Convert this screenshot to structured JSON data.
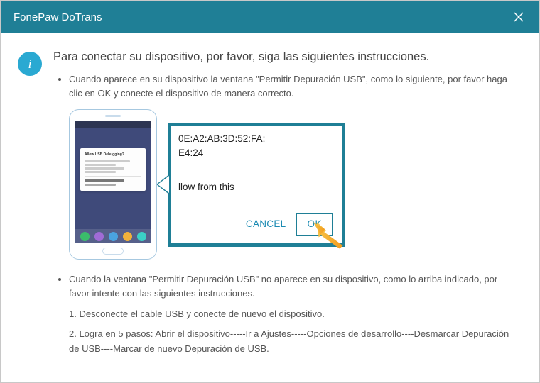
{
  "window": {
    "title": "FonePaw DoTrans"
  },
  "heading": "Para conectar su dispositivo, por favor, siga las siguientes instrucciones.",
  "bullets": {
    "item1": "Cuando aparece en su dispositivo la ventana \"Permitir Depuración USB\", como lo siguiente, por favor haga clic en OK y conecte el dispositivo de manera correcto.",
    "item2": "Cuando la ventana \"Permitir Depuración USB\" no aparece en su dispositivo, como lo arriba indicado, por favor intente con las siguientes instrucciones."
  },
  "illustration": {
    "phone_dialog_title": "Allow USB Debugging?",
    "zoom_mac_line1": "0E:A2:AB:3D:52:FA:",
    "zoom_mac_line2": "E4:24",
    "zoom_allow_text": "llow from this",
    "cancel": "CANCEL",
    "ok": "OK"
  },
  "steps": {
    "s1": "1. Desconecte el cable USB y conecte de nuevo el dispositivo.",
    "s2": "2. Logra en 5 pasos: Abrir el dispositivo-----Ir a Ajustes-----Opciones de desarrollo----Desmarcar Depuración de USB----Marcar de nuevo Depuración de USB."
  },
  "icons": {
    "info": "i"
  }
}
